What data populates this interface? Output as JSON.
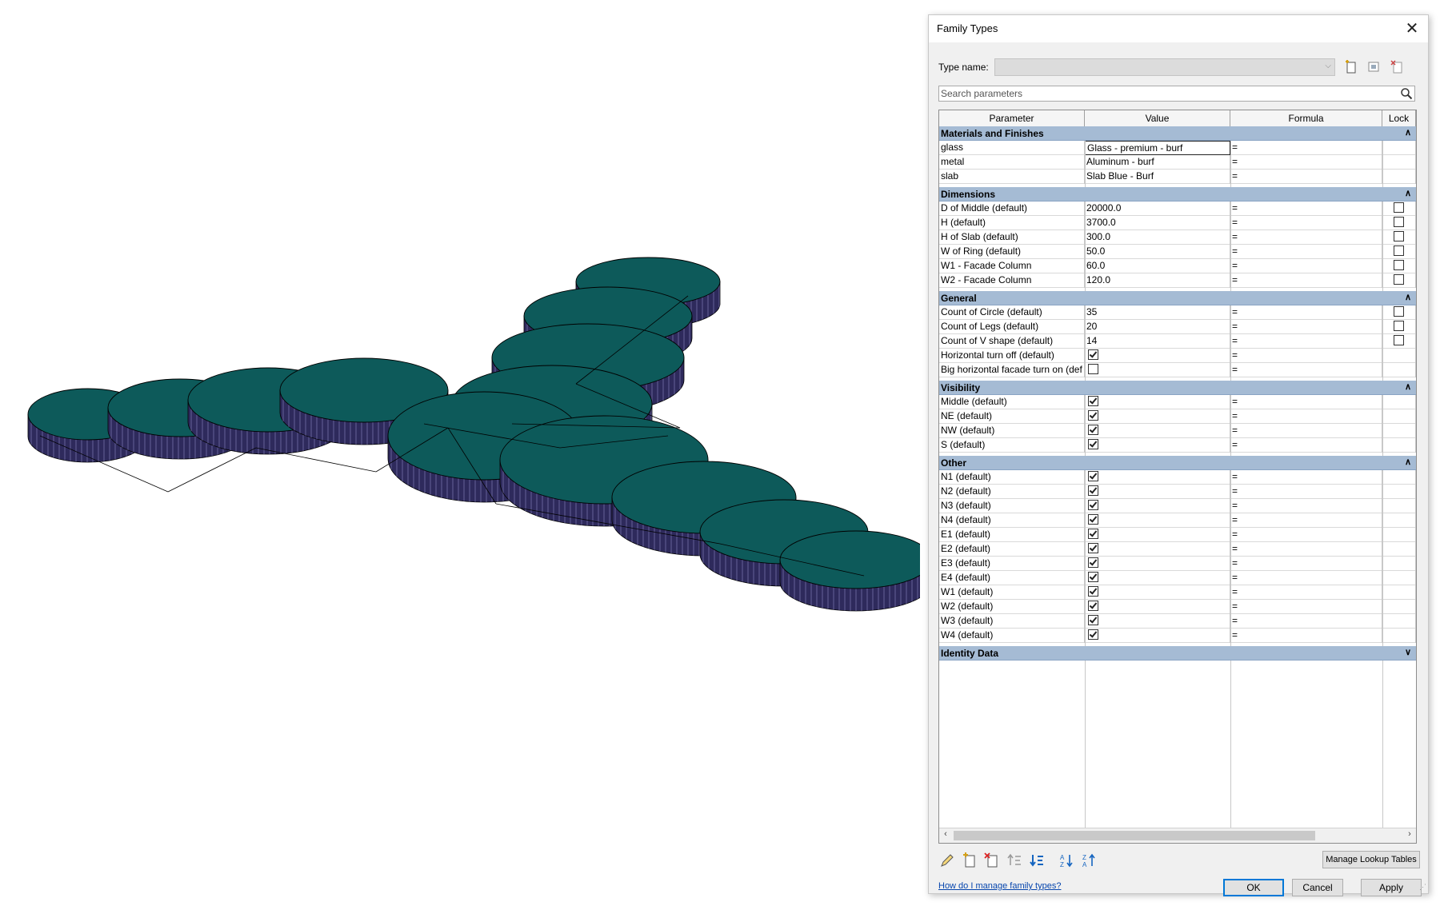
{
  "dialog": {
    "title": "Family Types",
    "type_name_label": "Type name:",
    "type_name_value": "",
    "search_placeholder": "Search parameters",
    "columns": [
      "Parameter",
      "Value",
      "Formula",
      "Lock"
    ],
    "groups": [
      {
        "name": "Materials and Finishes",
        "collapse_icon": "collapse-up-icon",
        "rows": [
          {
            "param": "glass",
            "value": "Glass - premium - burf",
            "formula": "=",
            "lock": null,
            "selected": true
          },
          {
            "param": "metal",
            "value": "Aluminum - burf",
            "formula": "=",
            "lock": null
          },
          {
            "param": "slab",
            "value": "Slab Blue - Burf",
            "formula": "=",
            "lock": null
          }
        ]
      },
      {
        "name": "Dimensions",
        "collapse_icon": "collapse-up-icon",
        "rows": [
          {
            "param": "D of Middle (default)",
            "value": "20000.0",
            "formula": "=",
            "lock": false
          },
          {
            "param": "H (default)",
            "value": "3700.0",
            "formula": "=",
            "lock": false
          },
          {
            "param": "H of Slab (default)",
            "value": "300.0",
            "formula": "=",
            "lock": false
          },
          {
            "param": "W of Ring (default)",
            "value": "50.0",
            "formula": "=",
            "lock": false
          },
          {
            "param": "W1 - Facade Column",
            "value": "60.0",
            "formula": "=",
            "lock": false
          },
          {
            "param": "W2 - Facade Column",
            "value": "120.0",
            "formula": "=",
            "lock": false
          }
        ]
      },
      {
        "name": "General",
        "collapse_icon": "collapse-up-icon",
        "rows": [
          {
            "param": "Count of Circle (default)",
            "value": "35",
            "formula": "=",
            "lock": false
          },
          {
            "param": "Count of Legs (default)",
            "value": "20",
            "formula": "=",
            "lock": false
          },
          {
            "param": "Count of V shape (default)",
            "value": "14",
            "formula": "=",
            "lock": false
          },
          {
            "param": "Horizontal turn off (default)",
            "check": true,
            "formula": "=",
            "lock": null
          },
          {
            "param": "Big horizontal facade turn on (def",
            "check": false,
            "formula": "=",
            "lock": null
          }
        ]
      },
      {
        "name": "Visibility",
        "collapse_icon": "collapse-up-icon",
        "rows": [
          {
            "param": "Middle (default)",
            "check": true,
            "formula": "=",
            "lock": null
          },
          {
            "param": "NE (default)",
            "check": true,
            "formula": "=",
            "lock": null
          },
          {
            "param": "NW (default)",
            "check": true,
            "formula": "=",
            "lock": null
          },
          {
            "param": "S (default)",
            "check": true,
            "formula": "=",
            "lock": null
          }
        ]
      },
      {
        "name": "Other",
        "collapse_icon": "collapse-up-icon",
        "rows": [
          {
            "param": "N1 (default)",
            "check": true,
            "formula": "=",
            "lock": null
          },
          {
            "param": "N2 (default)",
            "check": true,
            "formula": "=",
            "lock": null
          },
          {
            "param": "N3 (default)",
            "check": true,
            "formula": "=",
            "lock": null
          },
          {
            "param": "N4 (default)",
            "check": true,
            "formula": "=",
            "lock": null
          },
          {
            "param": "E1 (default)",
            "check": true,
            "formula": "=",
            "lock": null
          },
          {
            "param": "E2 (default)",
            "check": true,
            "formula": "=",
            "lock": null
          },
          {
            "param": "E3 (default)",
            "check": true,
            "formula": "=",
            "lock": null
          },
          {
            "param": "E4 (default)",
            "check": true,
            "formula": "=",
            "lock": null
          },
          {
            "param": "W1 (default)",
            "check": true,
            "formula": "=",
            "lock": null
          },
          {
            "param": "W2 (default)",
            "check": true,
            "formula": "=",
            "lock": null
          },
          {
            "param": "W3 (default)",
            "check": true,
            "formula": "=",
            "lock": null
          },
          {
            "param": "W4 (default)",
            "check": true,
            "formula": "=",
            "lock": null
          }
        ]
      },
      {
        "name": "Identity Data",
        "collapse_icon": "expand-down-icon",
        "rows": []
      }
    ],
    "toolbar_icons": [
      "pencil-icon",
      "new-parameter-icon",
      "delete-parameter-icon",
      "move-up-icon",
      "move-down-icon",
      "sort-ascending-icon",
      "sort-descending-icon"
    ],
    "manage_lookup_label": "Manage Lookup Tables",
    "help_link": "How do I manage family types?",
    "ok_label": "OK",
    "cancel_label": "Cancel",
    "apply_label": "Apply"
  },
  "colors": {
    "roof_top": "#0d5a5a",
    "facade_side": "#2e2a5c",
    "group_header": "#a5bbd4"
  }
}
